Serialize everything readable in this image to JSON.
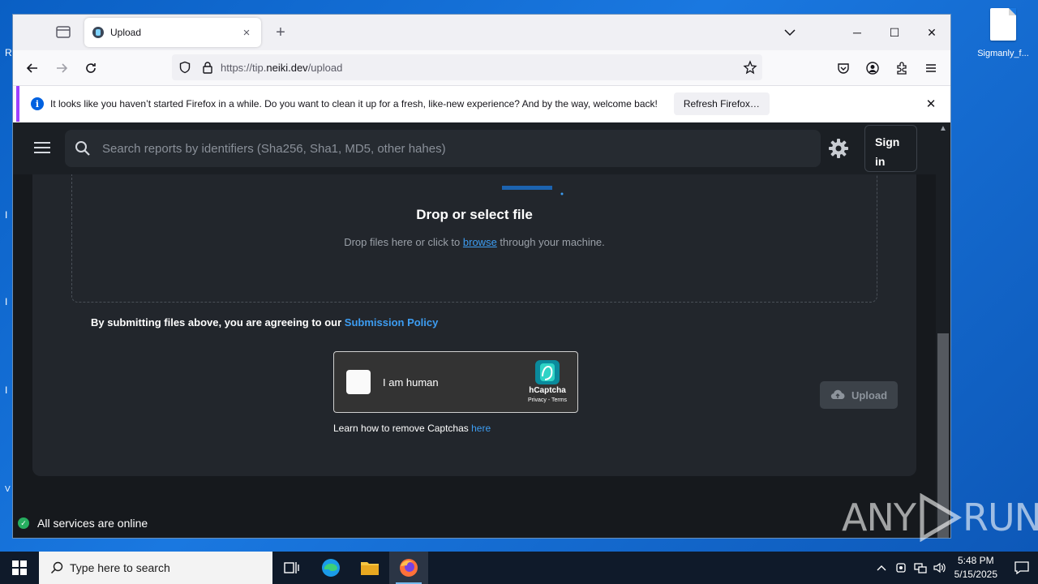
{
  "desktop": {
    "icon_file_label": "Sigmanly_f...",
    "left_fragments": [
      "R",
      "I",
      "I",
      "I",
      "V"
    ]
  },
  "browser": {
    "tab": {
      "title": "Upload",
      "close": "×"
    },
    "new_tab": "+",
    "window_controls": {
      "minimize": "─",
      "maximize": "☐",
      "close": "✕"
    },
    "url": {
      "prefix": "https://tip.",
      "domain": "neiki.dev",
      "path": "/upload"
    },
    "notice": {
      "icon": "i",
      "text": "It looks like you haven’t started Firefox in a while. Do you want to clean it up for a fresh, like-new experience? And by the way, welcome back!",
      "button": "Refresh Firefox…",
      "close": "✕"
    }
  },
  "page": {
    "search_placeholder": "Search reports by identifiers (Sha256, Sha1, MD5, other hahes)",
    "signin_label": "Sign in",
    "dropzone": {
      "title": "Drop or select file",
      "sub_before": "Drop files here or click to ",
      "sub_link": "browse",
      "sub_after": " through your machine."
    },
    "policy": {
      "text": "By submitting files above, you are agreeing to our ",
      "link": "Submission Policy"
    },
    "captcha": {
      "label": "I am human",
      "brand": "hCaptcha",
      "terms": "Privacy - Terms"
    },
    "learn": {
      "text": "Learn how to remove Captchas ",
      "link": "here"
    },
    "upload_label": "Upload",
    "status": "All services are online",
    "scroll_up": "▲"
  },
  "watermark": {
    "left": "ANY",
    "right": "RUN"
  },
  "taskbar": {
    "search_placeholder": "Type here to search",
    "time": "5:48 PM",
    "date": "5/15/2025"
  },
  "colors": {
    "accent_link": "#3d9df2",
    "status_ok": "#27ae60",
    "notice_border": "#9e3fff"
  }
}
